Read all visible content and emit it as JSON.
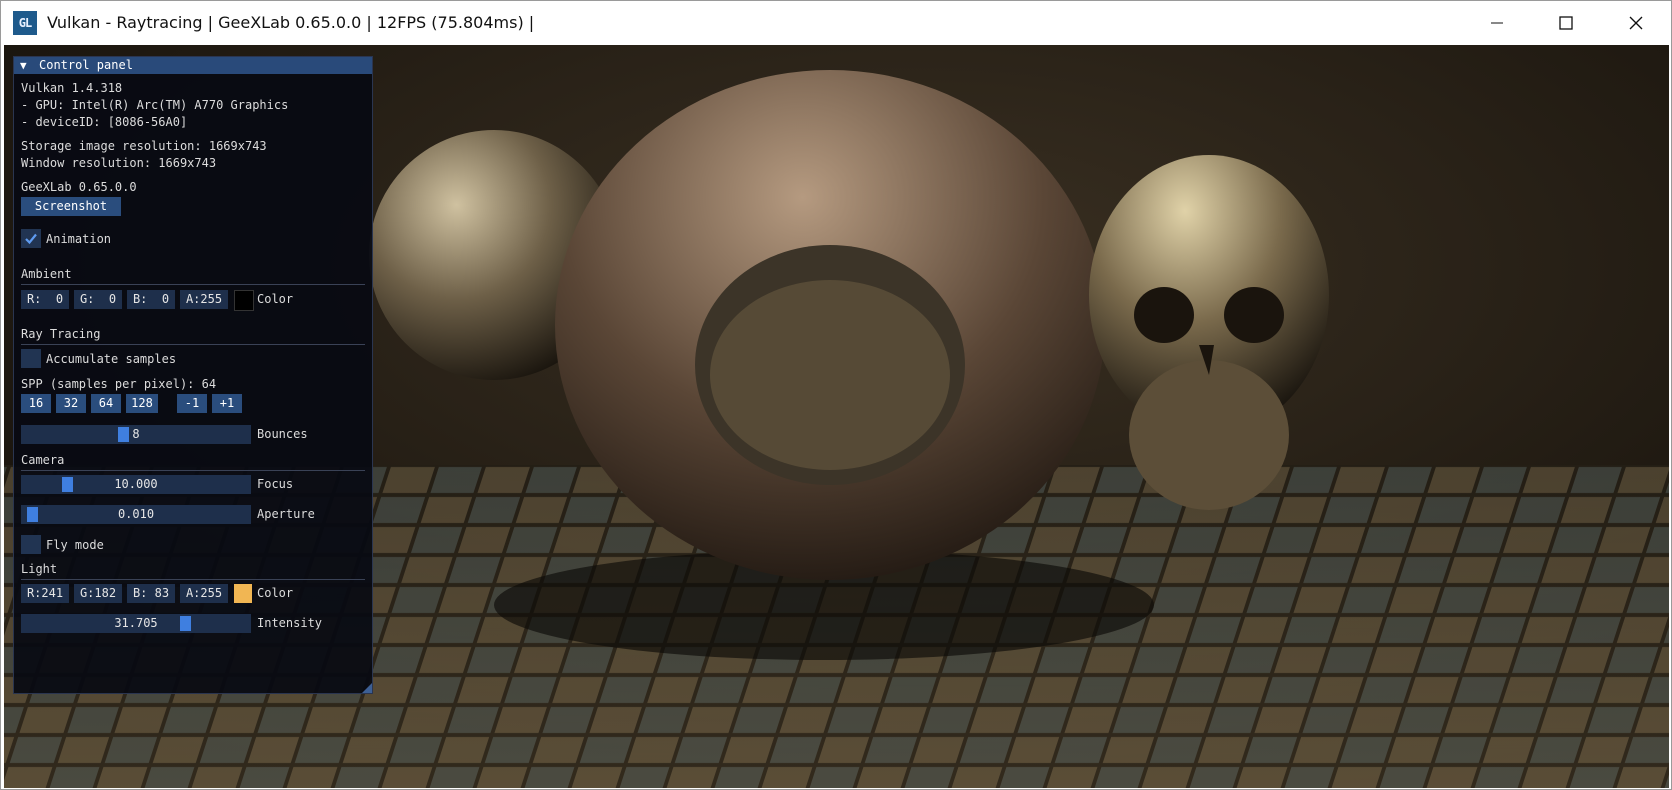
{
  "window": {
    "title": "Vulkan - Raytracing | GeeXLab 0.65.0.0 | 12FPS (75.804ms) |",
    "icon": "geexlab-app-icon",
    "icon_text": "GL"
  },
  "panel": {
    "title": "Control panel",
    "info": {
      "vulkan_version": "Vulkan 1.4.318",
      "gpu": "- GPU: Intel(R) Arc(TM) A770 Graphics",
      "device_id": "- deviceID: [8086-56A0]",
      "storage_res": "Storage image resolution: 1669x743",
      "window_res": "Window resolution: 1669x743",
      "geexlab_version": "GeeXLab 0.65.0.0"
    },
    "screenshot_button": "Screenshot",
    "animation": {
      "label": "Animation",
      "checked": true
    },
    "ambient": {
      "header": "Ambient",
      "r": "R:  0",
      "g": "G:  0",
      "b": "B:  0",
      "a": "A:255",
      "color_label": "Color",
      "swatch": "#000000"
    },
    "ray_tracing": {
      "header": "Ray Tracing",
      "accumulate": {
        "label": "Accumulate samples",
        "checked": false
      },
      "spp_label": "SPP (samples per pixel): 64",
      "spp_buttons": [
        "16",
        "32",
        "64",
        "128"
      ],
      "dec_button": "-1",
      "inc_button": "+1",
      "bounces": {
        "value": "8",
        "label": "Bounces",
        "fraction": 0.44
      }
    },
    "camera": {
      "header": "Camera",
      "focus": {
        "value": "10.000",
        "label": "Focus",
        "fraction": 0.18
      },
      "aperture": {
        "value": "0.010",
        "label": "Aperture",
        "fraction": 0.02
      },
      "fly_mode": {
        "label": "Fly mode",
        "checked": false
      }
    },
    "light": {
      "header": "Light",
      "r": "R:241",
      "g": "G:182",
      "b": "B: 83",
      "a": "A:255",
      "color_label": "Color",
      "swatch": "#f1b653",
      "intensity": {
        "value": "31.705",
        "label": "Intensity",
        "fraction": 0.73
      }
    }
  }
}
